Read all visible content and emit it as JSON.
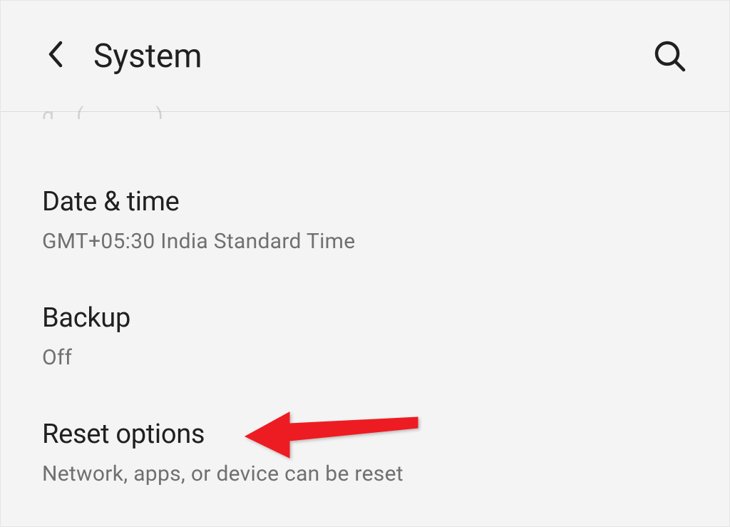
{
  "header": {
    "title": "System"
  },
  "menu_items": [
    {
      "title": "Date & time",
      "subtitle": "GMT+05:30 India Standard Time"
    },
    {
      "title": "Backup",
      "subtitle": "Off"
    },
    {
      "title": "Reset options",
      "subtitle": "Network, apps, or device can be reset"
    }
  ]
}
